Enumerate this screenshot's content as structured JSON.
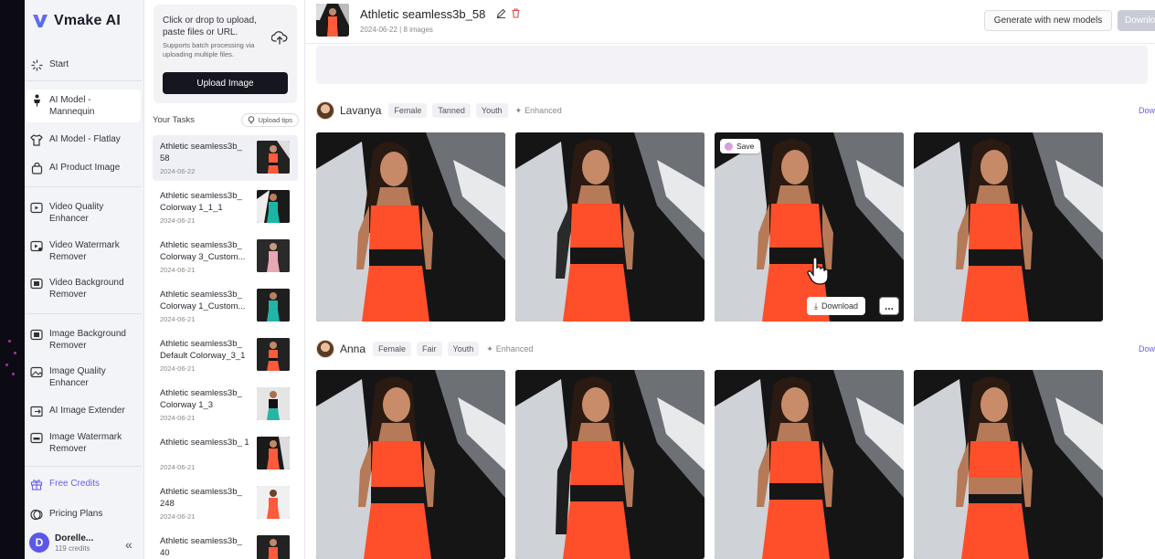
{
  "app": {
    "name": "Vmake AI",
    "brand_color": "#5b57e8"
  },
  "sidebar": {
    "items": [
      {
        "label": "Start",
        "icon": "loader-icon"
      },
      {
        "label": "AI Model - Mannequin",
        "icon": "mannequin-icon",
        "active": true
      },
      {
        "label": "AI Model - Flatlay",
        "icon": "shirt-icon"
      },
      {
        "label": "AI Product Image",
        "icon": "bag-icon"
      },
      {
        "label": "Video Quality Enhancer",
        "icon": "video-enhance-icon"
      },
      {
        "label": "Video Watermark Remover",
        "icon": "video-watermark-icon"
      },
      {
        "label": "Video Background Remover",
        "icon": "video-background-icon"
      },
      {
        "label": "Image Background Remover",
        "icon": "image-background-icon"
      },
      {
        "label": "Image Quality Enhancer",
        "icon": "image-enhance-icon"
      },
      {
        "label": "AI Image Extender",
        "icon": "extend-icon"
      },
      {
        "label": "Image Watermark Remover",
        "icon": "image-watermark-icon"
      },
      {
        "label": "Free Credits",
        "icon": "gift-icon"
      },
      {
        "label": "Pricing Plans",
        "icon": "coin-icon"
      }
    ],
    "user": {
      "initial": "D",
      "name": "Dorelle...",
      "credits": "119 credits"
    }
  },
  "upload": {
    "title": "Click or drop to upload, paste files or URL.",
    "subtitle": "Supports batch processing via uploading multiple files.",
    "button": "Upload Image"
  },
  "tasks": {
    "title": "Your Tasks",
    "tips": "Upload tips",
    "items": [
      {
        "name": "Athletic seamless3b_ 58",
        "date": "2024-06-22",
        "active": true
      },
      {
        "name": "Athletic seamless3b_ Colorway 1_1_1",
        "date": "2024-06-21"
      },
      {
        "name": "Athletic seamless3b_ Colorway 3_Custom...",
        "date": "2024-06-21"
      },
      {
        "name": "Athletic seamless3b_ Colorway 1_Custom...",
        "date": "2024-06-21"
      },
      {
        "name": "Athletic seamless3b_ Default Colorway_3_1",
        "date": "2024-06-21"
      },
      {
        "name": "Athletic seamless3b_ Colorway 1_3",
        "date": "2024-06-21"
      },
      {
        "name": "Athletic seamless3b_ 1",
        "date": "2024-06-21"
      },
      {
        "name": "Athletic seamless3b_ 248",
        "date": "2024-06-21"
      },
      {
        "name": "Athletic seamless3b_ 40",
        "date": ""
      }
    ]
  },
  "header": {
    "title": "Athletic seamless3b_58",
    "meta": "2024-06-22 | 8 images",
    "generate_label": "Generate with new models",
    "download_label": "Download"
  },
  "models": [
    {
      "name": "Lavanya",
      "tags": [
        "Female",
        "Tanned",
        "Youth"
      ],
      "enhanced": "Enhanced",
      "download": "Dow"
    },
    {
      "name": "Anna",
      "tags": [
        "Female",
        "Fair",
        "Youth"
      ],
      "enhanced": "Enhanced",
      "download": "Dow"
    }
  ],
  "photo_actions": {
    "save": "Save",
    "download": "Download",
    "more": "..."
  }
}
